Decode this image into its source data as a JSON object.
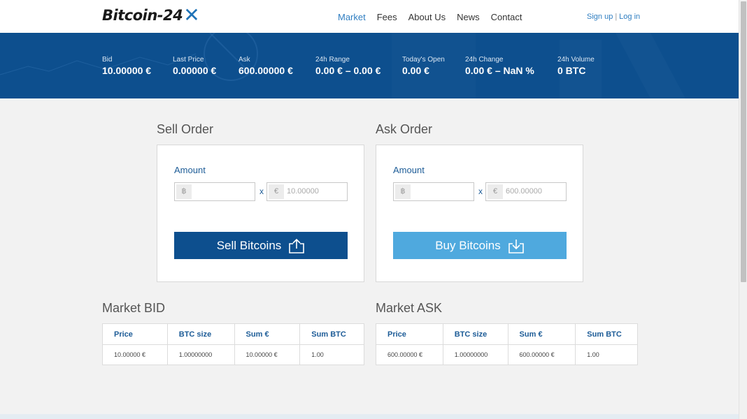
{
  "brand": {
    "name": "Bitcoin-24",
    "mark": "X"
  },
  "nav": {
    "items": [
      "Market",
      "Fees",
      "About Us",
      "News",
      "Contact"
    ],
    "active": "Market"
  },
  "auth": {
    "signup": "Sign up",
    "separator": "|",
    "login": "Log in"
  },
  "ticker": [
    {
      "label": "Bid",
      "value": "10.00000 €"
    },
    {
      "label": "Last Price",
      "value": "0.00000 €"
    },
    {
      "label": "Ask",
      "value": "600.00000 €"
    },
    {
      "label": "24h Range",
      "value": "0.00 € – 0.00 €"
    },
    {
      "label": "Today's Open",
      "value": "0.00 €"
    },
    {
      "label": "24h Change",
      "value": "0.00 € – NaN %"
    },
    {
      "label": "24h Volume",
      "value": "0 BTC"
    }
  ],
  "sell": {
    "title": "Sell Order",
    "amount_label": "Amount",
    "btc_symbol": "฿",
    "times": "x",
    "eur_symbol": "€",
    "price_placeholder": "10.00000",
    "button": "Sell Bitcoins"
  },
  "ask": {
    "title": "Ask Order",
    "amount_label": "Amount",
    "btc_symbol": "฿",
    "times": "x",
    "eur_symbol": "€",
    "price_placeholder": "600.00000",
    "button": "Buy Bitcoins"
  },
  "market_bid": {
    "title": "Market BID",
    "headers": [
      "Price",
      "BTC size",
      "Sum €",
      "Sum BTC"
    ],
    "rows": [
      [
        "10.00000 €",
        "1.00000000",
        "10.00000 €",
        "1.00"
      ]
    ]
  },
  "market_ask": {
    "title": "Market ASK",
    "headers": [
      "Price",
      "BTC size",
      "Sum €",
      "Sum BTC"
    ],
    "rows": [
      [
        "600.00000 €",
        "1.00000000",
        "600.00000 €",
        "1.00"
      ]
    ]
  },
  "colors": {
    "primary": "#0d4f8e",
    "accent": "#4fa9de",
    "link": "#2f7ec1"
  }
}
